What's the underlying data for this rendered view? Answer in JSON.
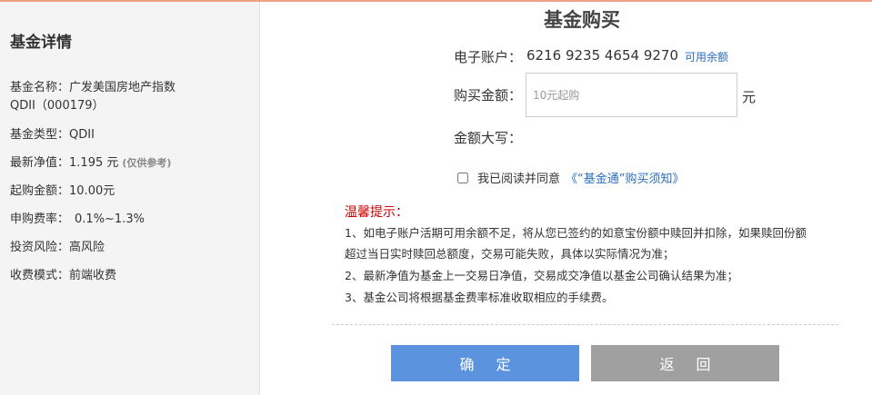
{
  "sidebar": {
    "title": "基金详情",
    "fund_name_label": "基金名称：",
    "fund_name": "广发美国房地产指数",
    "fund_code": "QDII（000179）",
    "fund_type_label": "基金类型：",
    "fund_type": "QDII",
    "nav_label": "最新净值：",
    "nav_value": "1.195 元",
    "nav_hint": "(仅供参考)",
    "min_purchase_label": "起购金额：",
    "min_purchase": "10.00元",
    "fee_label": "申购费率：",
    "fee": "0.1%~1.3%",
    "risk_label": "投资风险：",
    "risk": "高风险",
    "charge_label": "收费模式：",
    "charge": "前端收费"
  },
  "main": {
    "title": "基金购买",
    "account_label": "电子账户：",
    "account_number": "6216 9235 4654 9270",
    "available_link": "可用余额",
    "amount_label": "购买金额：",
    "amount_placeholder": "10元起购",
    "amount_unit": "元",
    "capital_label": "金额大写：",
    "agree_text": "我已阅读并同意",
    "agree_link": "《“基金通”购买须知》",
    "tips_title": "温馨提示：",
    "tip1_line1": "1、如电子账户活期可用余额不足，将从您已签约的如意宝份额中赎回并扣除，如果赎回份额",
    "tip1_line2": "超过当日实时赎回总额度，交易可能失败，具体以实际情况为准；",
    "tip2": "2、最新净值为基金上一交易日净值，交易成交净值以基金公司确认结果为准；",
    "tip3": "3、基金公司将根据基金费率标准收取相应的手续费。",
    "confirm_button": "确定",
    "back_button": "返回"
  },
  "colors": {
    "confirm": "#5b93df",
    "back": "#a0a0a0",
    "link": "#2a6ebd",
    "warning": "#cc0000"
  }
}
